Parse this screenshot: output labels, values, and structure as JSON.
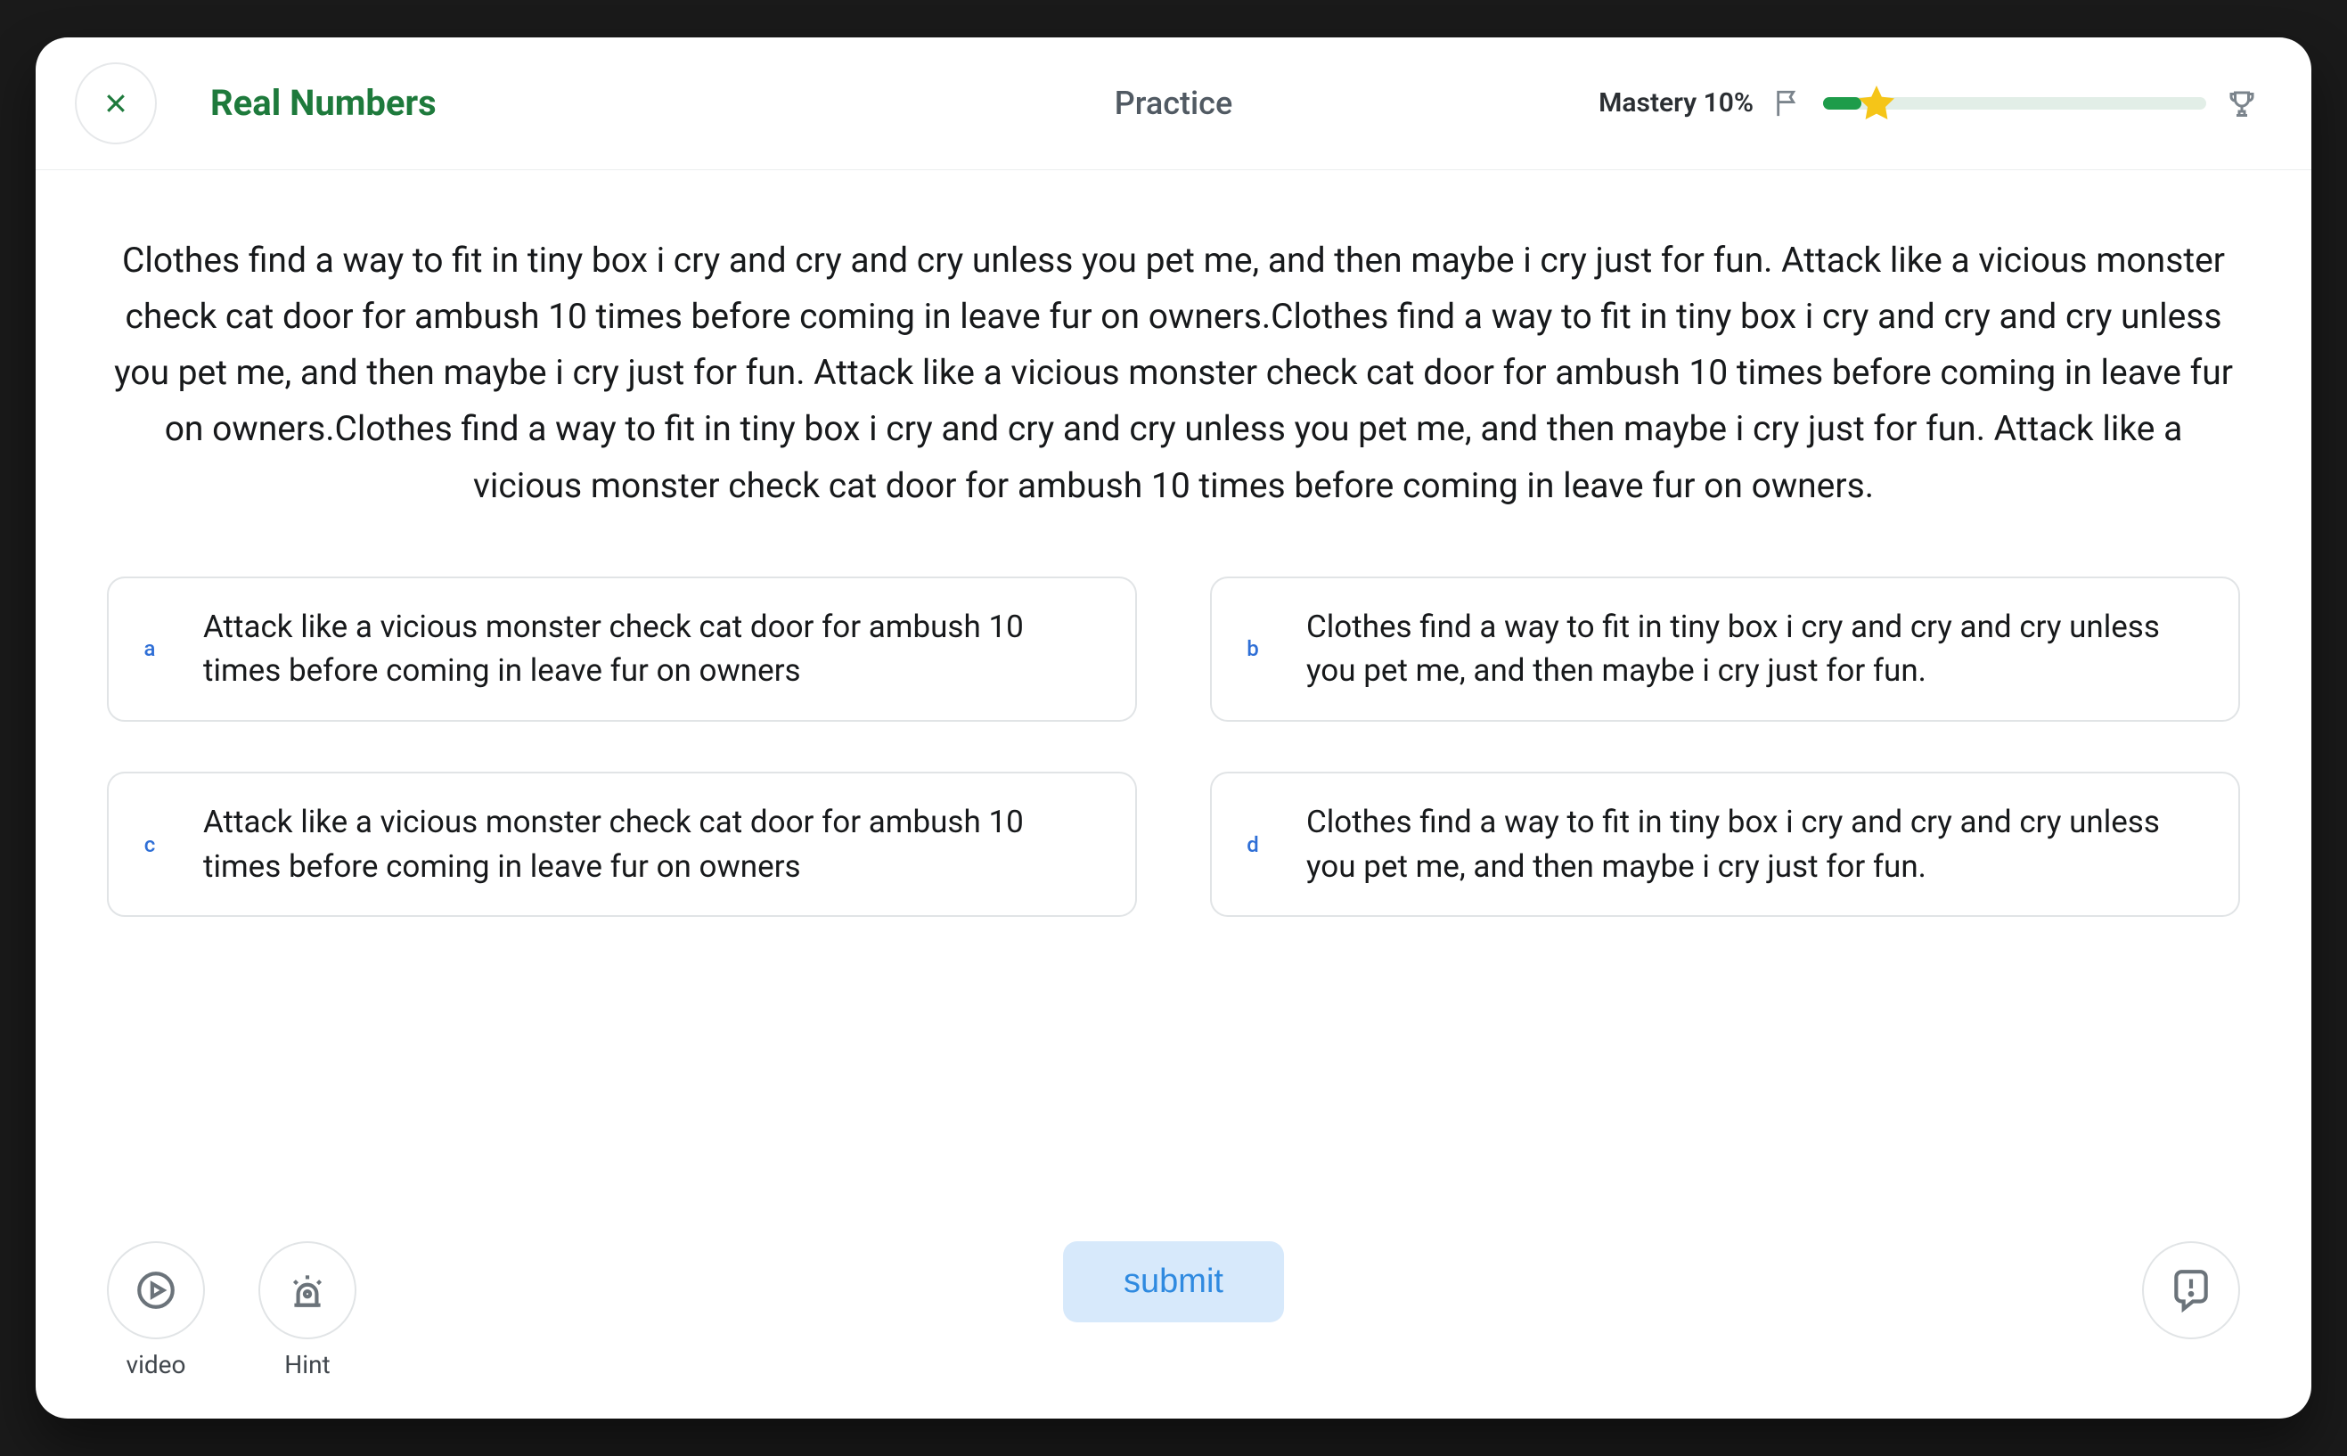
{
  "header": {
    "title": "Real Numbers",
    "mode": "Practice",
    "mastery_label": "Mastery 10%",
    "progress_percent": 10,
    "star_position_percent": 14
  },
  "question": "Clothes find a way to fit in tiny box i cry and cry and cry unless you pet me, and then maybe i cry just for fun. Attack like a vicious monster check cat door for ambush 10 times before coming in leave fur on owners.Clothes find a way to fit in tiny box i cry and cry and cry unless you pet me, and then maybe i cry just for fun. Attack like a vicious monster check cat door for ambush 10 times before coming in leave fur on owners.Clothes find a way to fit in tiny box i cry and cry and cry unless you pet me, and then maybe i cry just for fun. Attack like a vicious monster check cat door for ambush 10 times before coming in leave fur on owners.",
  "options": [
    {
      "key": "a",
      "text": "Attack like a vicious monster check cat door for ambush 10 times before coming in leave fur on owners"
    },
    {
      "key": "b",
      "text": "Clothes find a way to fit in tiny box i cry and cry and cry unless you pet me, and then maybe i cry just for fun."
    },
    {
      "key": "c",
      "text": "Attack like a vicious monster check cat door for ambush 10 times before coming in leave fur on owners"
    },
    {
      "key": "d",
      "text": "Clothes find a way to fit in tiny box i cry and cry and cry unless you pet me, and then maybe i cry just for fun."
    }
  ],
  "footer": {
    "video_label": "video",
    "hint_label": "Hint",
    "submit_label": "submit"
  }
}
